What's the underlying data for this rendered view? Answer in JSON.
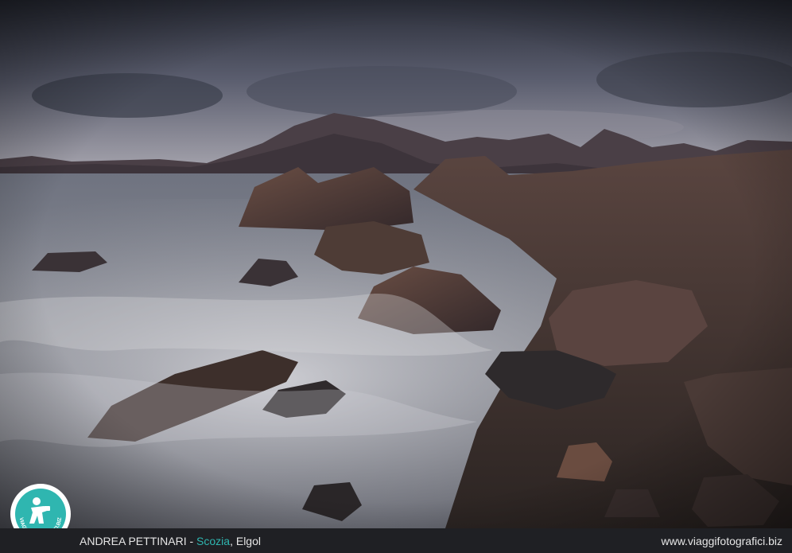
{
  "caption": {
    "author": "ANDREA PETTINARI",
    "separator": " - ",
    "country": "Scozia",
    "comma": ", ",
    "place": "Elgol",
    "website": "www.viaggifotografici.biz"
  },
  "logo": {
    "text": "VIAGGIFOTOGRAFICI.BIZ",
    "icon": "photographer-silhouette-icon"
  },
  "colors": {
    "accent": "#2fb6b0",
    "bar": "#1f2024",
    "text": "#e6e6e6"
  }
}
